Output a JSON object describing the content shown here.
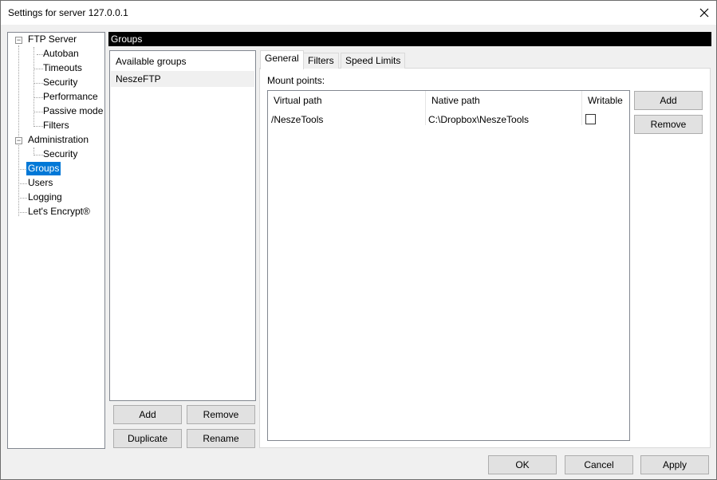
{
  "window": {
    "title": "Settings for server 127.0.0.1"
  },
  "tree": {
    "items": [
      {
        "label": "FTP Server"
      },
      {
        "label": "Autoban"
      },
      {
        "label": "Timeouts"
      },
      {
        "label": "Security"
      },
      {
        "label": "Performance"
      },
      {
        "label": "Passive mode"
      },
      {
        "label": "Filters"
      },
      {
        "label": "Administration"
      },
      {
        "label": "Security"
      },
      {
        "label": "Groups"
      },
      {
        "label": "Users"
      },
      {
        "label": "Logging"
      },
      {
        "label": "Let's Encrypt®"
      }
    ],
    "selected": "Groups"
  },
  "page": {
    "header": "Groups"
  },
  "groups": {
    "list_header": "Available groups",
    "items": [
      "NeszeFTP"
    ],
    "buttons": {
      "add": "Add",
      "remove": "Remove",
      "duplicate": "Duplicate",
      "rename": "Rename"
    }
  },
  "tabs": [
    {
      "label": "General"
    },
    {
      "label": "Filters"
    },
    {
      "label": "Speed Limits"
    }
  ],
  "general": {
    "mount_points_label": "Mount points:",
    "columns": [
      "Virtual path",
      "Native path",
      "Writable"
    ],
    "rows": [
      {
        "virtual_path": "/NeszeTools",
        "native_path": "C:\\Dropbox\\NeszeTools",
        "writable": false
      }
    ],
    "buttons": {
      "add": "Add",
      "remove": "Remove"
    }
  },
  "footer": {
    "ok": "OK",
    "cancel": "Cancel",
    "apply": "Apply"
  }
}
